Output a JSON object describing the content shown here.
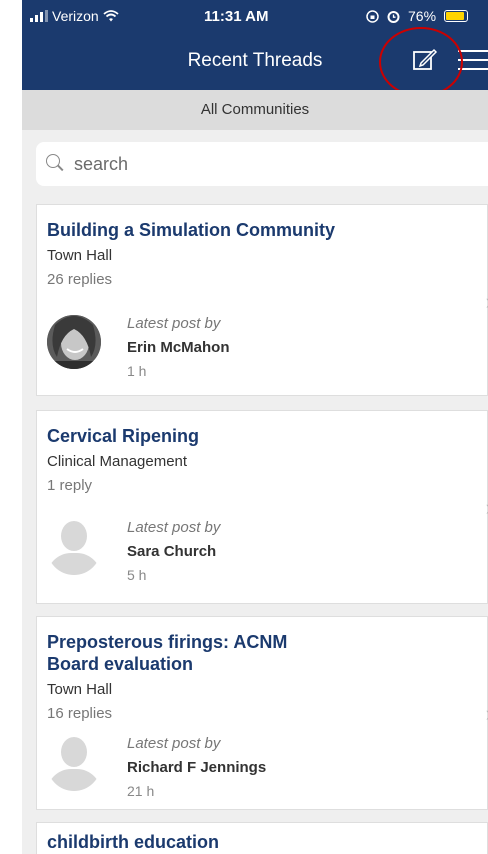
{
  "status_bar": {
    "carrier": "Verizon",
    "time": "11:31 AM",
    "battery": "76%"
  },
  "header": {
    "title": "Recent Threads",
    "compose_icon": "compose-icon",
    "menu_icon": "hamburger-menu-icon"
  },
  "filter": {
    "label": "All Communities"
  },
  "search": {
    "placeholder": "search"
  },
  "threads": [
    {
      "title": "Building a Simulation Community",
      "community": "Town Hall",
      "replies": "26 replies",
      "latest_label": "Latest post by",
      "author": "Erin McMahon",
      "age": "1 h"
    },
    {
      "title": "Cervical Ripening",
      "community": "Clinical Management",
      "replies": "1 reply",
      "latest_label": "Latest post by",
      "author": "Sara Church",
      "age": "5 h"
    },
    {
      "title_line1": "Preposterous firings: ACNM",
      "title_line2": "Board evaluation",
      "community": "Town Hall",
      "replies": "16 replies",
      "latest_label": "Latest post by",
      "author": "Richard F Jennings",
      "age": "21 h"
    },
    {
      "title": "childbirth education"
    }
  ],
  "colors": {
    "header_bg": "#1b3a6e",
    "title_text": "#1b3a6e",
    "battery": "#ffd400",
    "highlight_circle": "#cc0000"
  }
}
